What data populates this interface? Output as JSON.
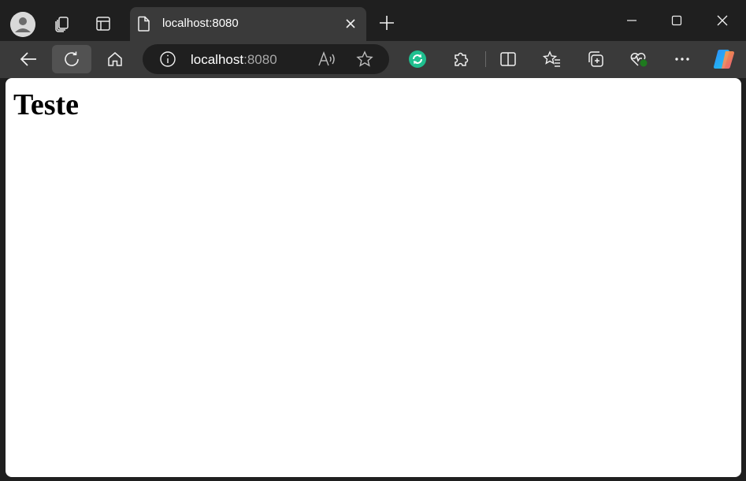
{
  "browser": {
    "tab": {
      "title": "localhost:8080"
    },
    "address_bar": {
      "host": "localhost",
      "port": ":8080"
    },
    "icons": {
      "profile": "profile-avatar-icon",
      "workspaces": "workspaces-icon",
      "tab_actions": "tab-actions-icon",
      "page": "page-icon",
      "close_tab": "close-icon",
      "new_tab": "plus-icon",
      "minimize": "minimize-icon",
      "maximize": "maximize-icon",
      "close_window": "close-window-icon",
      "back": "back-arrow-icon",
      "refresh": "refresh-icon",
      "home": "home-icon",
      "site_info": "info-icon",
      "read_aloud": "read-aloud-icon",
      "favorite": "star-icon",
      "extension_sync": "sync-extension-icon",
      "extensions": "puzzle-icon",
      "split_screen": "split-screen-icon",
      "favorites": "favorites-list-icon",
      "collections": "collections-icon",
      "browser_essentials": "heart-pulse-icon",
      "more": "more-dots-icon",
      "copilot": "copilot-icon"
    },
    "colors": {
      "frame": "#1f1f1f",
      "toolbar": "#3a3a3a",
      "active_tab": "#3a3a3a",
      "address_bg": "#1f1f1f",
      "extension_green": "#1fbf8f",
      "status_dot": "#1e7a1e"
    }
  },
  "page": {
    "heading": "Teste"
  }
}
